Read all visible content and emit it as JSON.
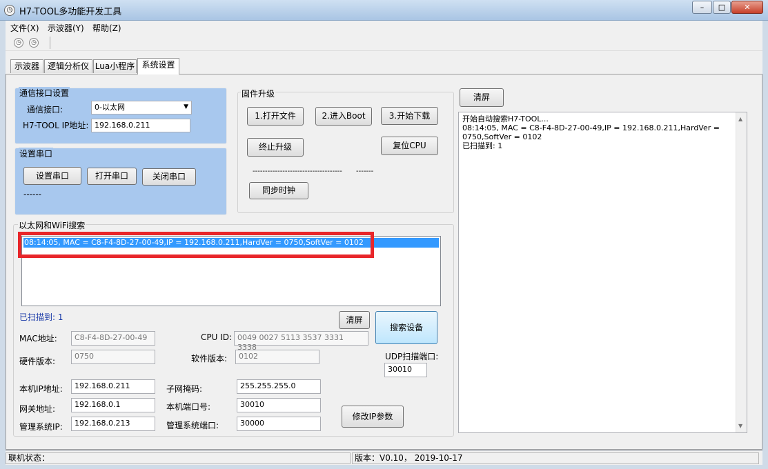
{
  "window": {
    "title": "H7-TOOL多功能开发工具",
    "min": "–",
    "max": "□",
    "close": "✕"
  },
  "menu": [
    {
      "label": "文件(X)"
    },
    {
      "label": "示波器(Y)"
    },
    {
      "label": "帮助(Z)"
    }
  ],
  "toolbar": {
    "icons": [
      "clock-icon",
      "clock-icon"
    ]
  },
  "tabs": [
    {
      "label": "示波器"
    },
    {
      "label": "逻辑分析仪"
    },
    {
      "label": "Lua小程序"
    },
    {
      "label": "系统设置",
      "active": true
    }
  ],
  "comm": {
    "title": "通信接口设置",
    "iface_label": "通信接口:",
    "iface_value": "0-以太网",
    "ip_label": "H7-TOOL IP地址:",
    "ip_value": "192.168.0.211"
  },
  "serial": {
    "title": "设置串口",
    "set_btn": "设置串口",
    "open_btn": "打开串口",
    "close_btn": "关闭串口",
    "status": "------"
  },
  "firmware": {
    "title": "固件升级",
    "open_file": "1.打开文件",
    "enter_boot": "2.进入Boot",
    "start_download": "3.开始下载",
    "stop": "终止升级",
    "reset_cpu": "复位CPU",
    "dashes_left": "------------------------------------",
    "dashes_right": "-------",
    "sync_clock": "同步时钟"
  },
  "log": {
    "clear_btn": "清屏",
    "lines": [
      "开始自动搜索H7-TOOL...",
      "08:14:05, MAC = C8-F4-8D-27-00-49,IP = 192.168.0.211,HardVer =",
      "0750,SoftVer = 0102",
      "已扫描到: 1"
    ]
  },
  "search": {
    "title": "以太网和WiFi搜索",
    "results": [
      "08:14:05, MAC = C8-F4-8D-27-00-49,IP = 192.168.0.211,HardVer = 0750,SoftVer = 0102"
    ],
    "scanned": "已扫描到: 1",
    "clear_btn": "清屏",
    "search_btn": "搜索设备",
    "mac_label": "MAC地址:",
    "mac_value": "C8-F4-8D-27-00-49",
    "cpuid_label": "CPU ID:",
    "cpuid_value": "0049 0027 5113 3537 3331 3338",
    "hw_label": "硬件版本:",
    "hw_value": "0750",
    "sw_label": "软件版本:",
    "sw_value": "0102",
    "udp_label": "UDP扫描端口:",
    "udp_value": "30010",
    "local_ip_label": "本机IP地址:",
    "local_ip_value": "192.168.0.211",
    "mask_label": "子网掩码:",
    "mask_value": "255.255.255.0",
    "gw_label": "网关地址:",
    "gw_value": "192.168.0.1",
    "port_label": "本机端口号:",
    "port_value": "30010",
    "mgr_ip_label": "管理系统IP:",
    "mgr_ip_value": "192.168.0.213",
    "mgr_port_label": "管理系统端口:",
    "mgr_port_value": "30000",
    "modify_btn": "修改IP参数"
  },
  "status": {
    "left": "联机状态：",
    "version": "版本：V0.10， 2019-10-17"
  }
}
